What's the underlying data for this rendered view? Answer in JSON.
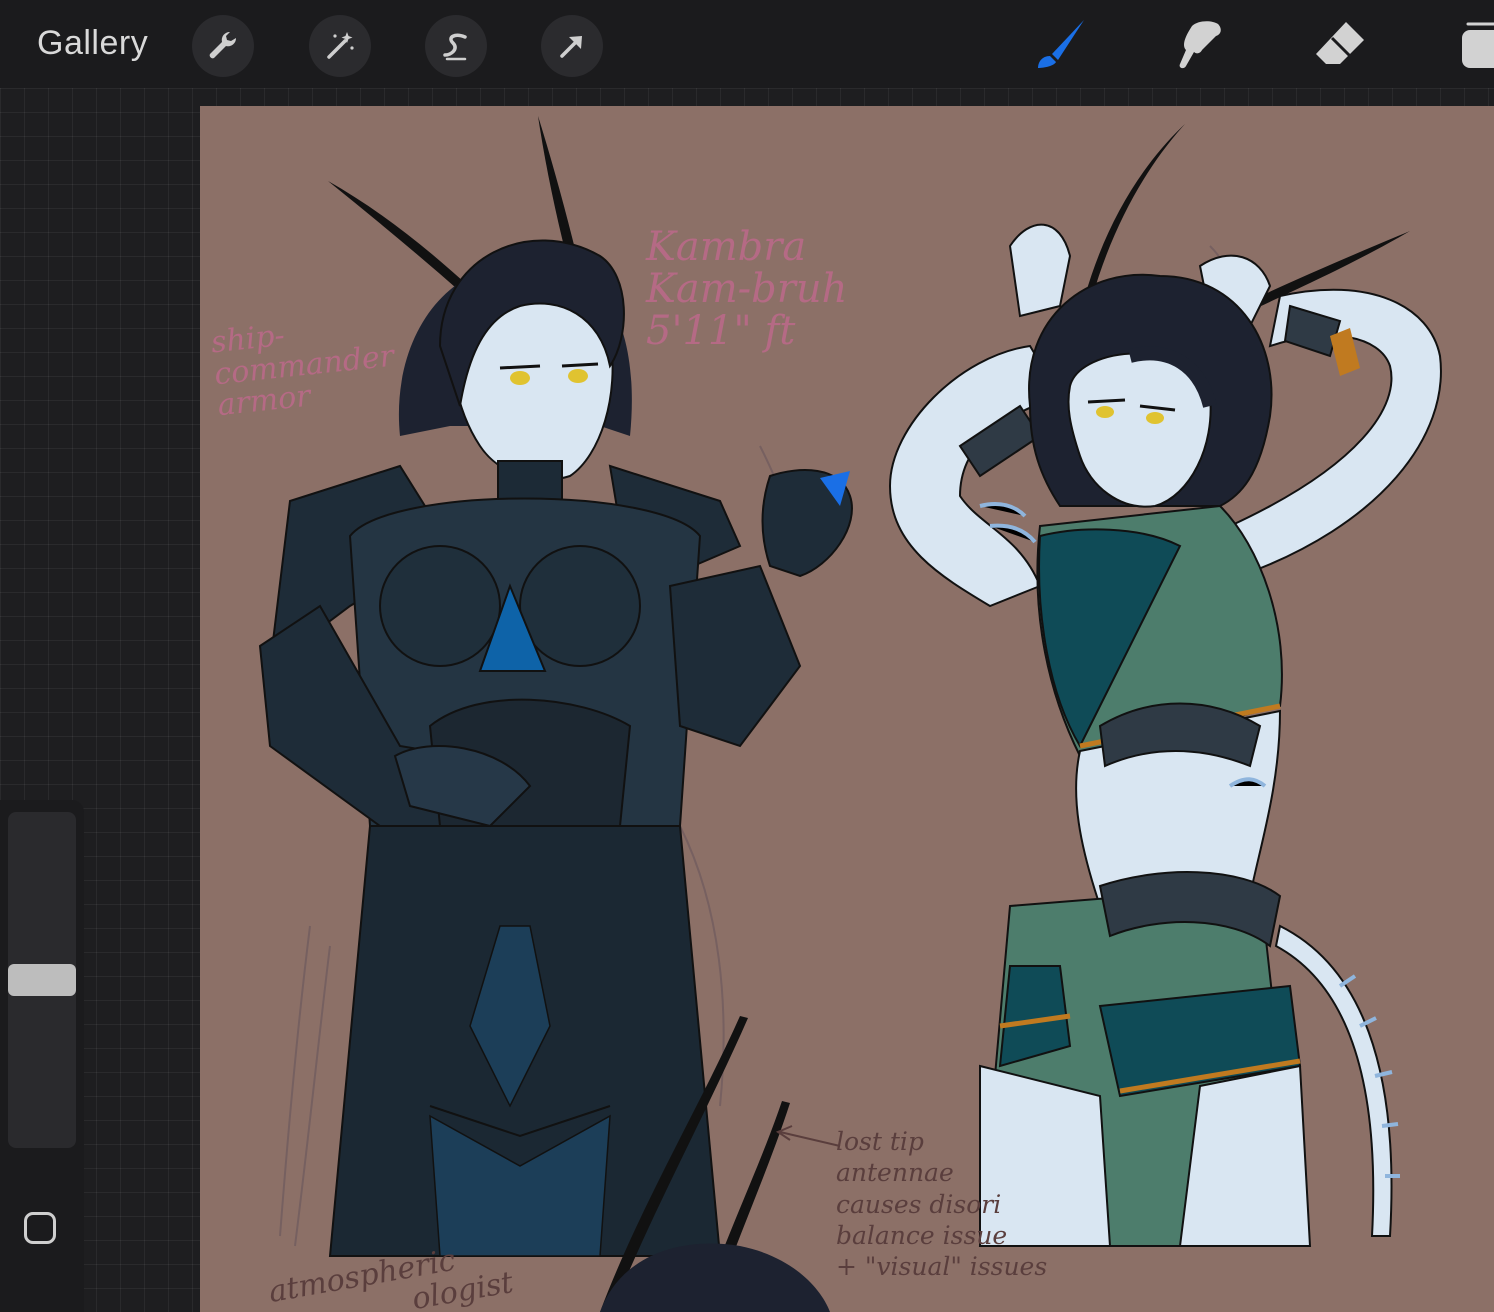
{
  "toolbar": {
    "gallery_label": "Gallery",
    "left_tools": [
      {
        "name": "wrench-icon",
        "label": "Actions"
      },
      {
        "name": "magic-wand-icon",
        "label": "Adjustments"
      },
      {
        "name": "selection-icon",
        "label": "Selection"
      },
      {
        "name": "transform-arrow-icon",
        "label": "Transform"
      }
    ],
    "right_tools": [
      {
        "name": "brush-icon",
        "active": true
      },
      {
        "name": "smudge-icon",
        "active": false
      },
      {
        "name": "eraser-icon",
        "active": false
      },
      {
        "name": "layers-icon",
        "active": false
      }
    ]
  },
  "colors": {
    "active_tool": "#1a6fe6",
    "canvas_bg": "#8c7067",
    "workspace_bg": "#1e1e20",
    "toolbar_bg": "#1b1b1d"
  },
  "sidebar": {
    "brush_size_level": 0.5
  },
  "canvas_notes": {
    "name_lines": [
      "Kambra",
      "Kam-bruh",
      "5'11\" ft"
    ],
    "armor_lines": [
      "ship-",
      "commander",
      "armor"
    ],
    "antenna_lines": [
      "lost tip",
      "antennae",
      "causes disori",
      "balance issue",
      "+ \"visual\" issues"
    ],
    "bottom_lines": [
      "atmospheric",
      "ologist"
    ]
  }
}
